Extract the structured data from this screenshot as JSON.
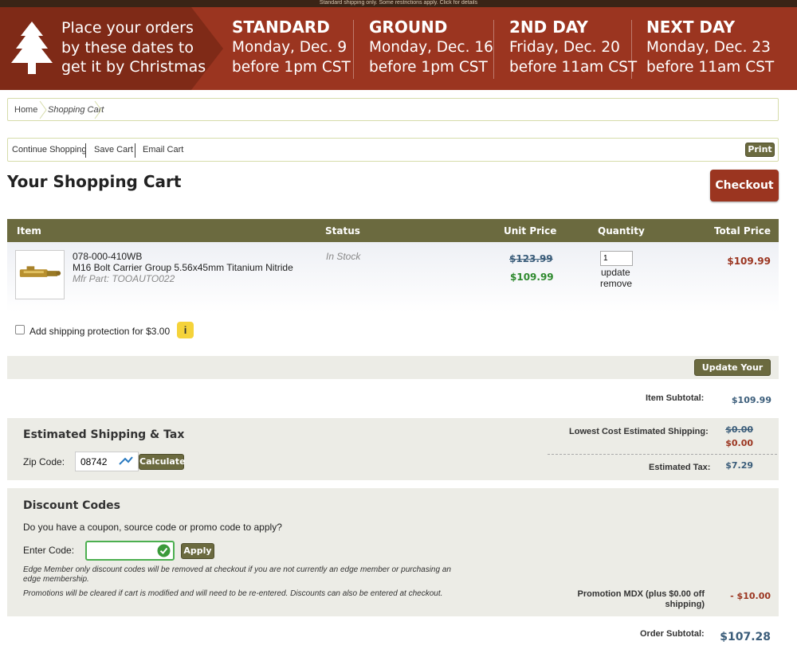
{
  "banner": {
    "top_notice": "Standard shipping only. Some restrictions apply. Click for details",
    "intro": "Place your orders by these dates to get it by Christmas",
    "columns": [
      {
        "name": "STANDARD",
        "date": "Monday, Dec. 9",
        "cutoff": "before 1pm CST"
      },
      {
        "name": "GROUND",
        "date": "Monday, Dec. 16",
        "cutoff": "before 1pm CST"
      },
      {
        "name": "2ND DAY",
        "date": "Friday, Dec. 20",
        "cutoff": "before 11am CST"
      },
      {
        "name": "NEXT DAY",
        "date": "Monday, Dec. 23",
        "cutoff": "before 11am CST"
      }
    ],
    "colors": {
      "banner": "#9b3520",
      "intro": "#7f2a17"
    }
  },
  "breadcrumb": {
    "home": "Home",
    "current": "Shopping Cart"
  },
  "actions": {
    "continue": "Continue Shopping",
    "save": "Save Cart",
    "email": "Email Cart",
    "print": "Print"
  },
  "page": {
    "title": "Your Shopping Cart",
    "checkout": "Checkout"
  },
  "table": {
    "headers": {
      "item": "Item",
      "status": "Status",
      "unit_price": "Unit Price",
      "quantity": "Quantity",
      "total_price": "Total Price"
    },
    "items": [
      {
        "sku": "078-000-410WB",
        "name": "M16 Bolt Carrier Group 5.56x45mm Titanium Nitride",
        "mfr": "Mfr Part: TOOAUTO022",
        "status": "In Stock",
        "old_price": "$123.99",
        "price": "$109.99",
        "quantity": "1",
        "update": "update",
        "remove": "remove",
        "total": "$109.99"
      }
    ]
  },
  "protection": {
    "label": "Add shipping protection for $3.00",
    "info": "i",
    "checked": false
  },
  "cart": {
    "update_button": "Update Your Cart",
    "subtotal_label": "Item Subtotal:",
    "subtotal": "$109.99"
  },
  "shipping": {
    "title": "Estimated Shipping & Tax",
    "zip_label": "Zip Code:",
    "zip_value": "08742",
    "calculate": "Calculate",
    "lowest_label": "Lowest Cost Estimated Shipping:",
    "old_value": "$0.00",
    "value": "$0.00",
    "tax_label": "Estimated Tax:",
    "tax": "$7.29"
  },
  "discount": {
    "title": "Discount Codes",
    "question": "Do you have a coupon, source code or promo code to apply?",
    "code_label": "Enter Code:",
    "code_value": "",
    "apply": "Apply",
    "note1": "Edge Member only discount codes will be removed at checkout if you are not currently an edge member or purchasing an edge membership.",
    "note2": "Promotions will be cleared if cart is modified and will need to be re-entered. Discounts can also be entered at checkout.",
    "promo_label": "Promotion MDX (plus $0.00 off shipping)",
    "promo_value": "- $10.00"
  },
  "order": {
    "subtotal_label": "Order Subtotal:",
    "subtotal": "$107.28"
  },
  "icons": {
    "tree": "christmas-tree-icon",
    "zip": "location-pin-icon",
    "check": "check-circle-icon"
  }
}
